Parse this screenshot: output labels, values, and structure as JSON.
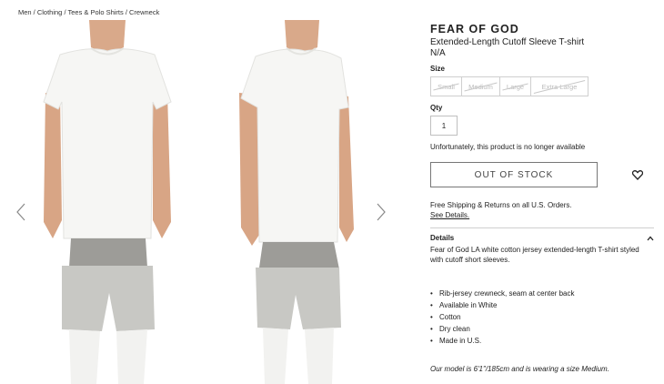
{
  "breadcrumb": "Men / Clothing / Tees & Polo Shirts / Crewneck",
  "product": {
    "brand": "FEAR OF GOD",
    "name": "Extended-Length Cutoff Sleeve T-shirt",
    "price": "N/A"
  },
  "size": {
    "label": "Size",
    "options": [
      "Small",
      "Medium",
      "Large",
      "Extra Large"
    ]
  },
  "qty": {
    "label": "Qty",
    "value": "1"
  },
  "availability": "Unfortunately, this product is no longer available",
  "cta": {
    "label": "OUT OF STOCK"
  },
  "shipping": {
    "text": "Free Shipping & Returns on all U.S. Orders.",
    "link": "See Details."
  },
  "details": {
    "title": "Details",
    "description": "Fear of God LA white cotton jersey extended-length T-shirt styled with cutoff short sleeves.",
    "bullets": [
      "Rib-jersey crewneck, seam at center back",
      "Available in White",
      "Cotton",
      "Dry clean",
      "Made in U.S."
    ],
    "model_note": "Our model is 6'1\"/185cm and is wearing a size Medium."
  },
  "icons": {
    "prev": "chevron-left-icon",
    "next": "chevron-right-icon",
    "wishlist": "heart-icon",
    "collapse": "chevron-up-icon"
  }
}
